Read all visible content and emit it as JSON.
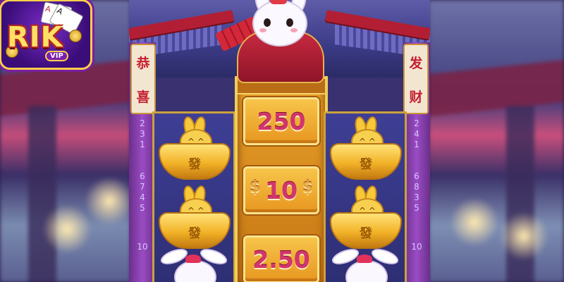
{
  "logo": {
    "brand": "RIK",
    "badge": "VIP",
    "card_a": "A",
    "card_b": "A"
  },
  "left_banner": {
    "chars": [
      "恭",
      "喜"
    ]
  },
  "right_banner": {
    "chars": [
      "发",
      "财"
    ]
  },
  "paylines": {
    "left_top": [
      "2",
      "3",
      "1"
    ],
    "left_bottom": [
      "6",
      "7",
      "4",
      "5"
    ],
    "left_last": "10",
    "right_top": [
      "2",
      "4",
      "1"
    ],
    "right_bottom": [
      "6",
      "8",
      "3",
      "5"
    ],
    "right_last": "10"
  },
  "center_reel": {
    "prizes": [
      "250",
      "10",
      "2.50"
    ],
    "currency_glyph": "$"
  },
  "symbols": {
    "ingot_mark": "發",
    "ingot_face": "^ ^"
  },
  "colors": {
    "frame_gold": "#caa23c",
    "prize_text": "#d2356d",
    "pillar_purple": "#9a4cc4",
    "temple_red": "#b21f34"
  },
  "icons": {
    "logo": "rik-vip-logo",
    "mascot": "rabbit-mascot",
    "ingot": "gold-ingot-rabbit-symbol",
    "bunny": "white-bunny-symbol"
  }
}
